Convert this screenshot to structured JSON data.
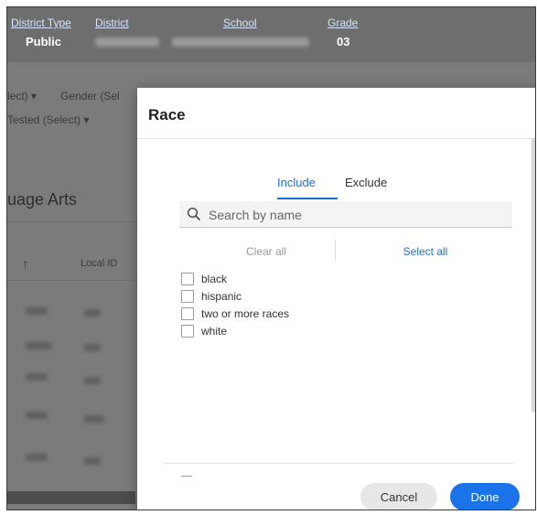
{
  "header": {
    "columns": [
      "District Type",
      "District",
      "School",
      "Grade"
    ],
    "values": {
      "district_type": "Public",
      "grade": "03"
    }
  },
  "background": {
    "filters": [
      "lect)",
      "Gender (Sel",
      "Tested (Select)"
    ],
    "section_title": "uage Arts",
    "table_headers": [
      "↑",
      "Local ID"
    ]
  },
  "modal": {
    "title": "Race",
    "tabs": {
      "include": "Include",
      "exclude": "Exclude",
      "active": "include"
    },
    "search": {
      "placeholder": "Search by name",
      "value": ""
    },
    "clear_all_label": "Clear all",
    "select_all_label": "Select all",
    "options": [
      "black",
      "hispanic",
      "two or more races",
      "white"
    ],
    "buttons": {
      "cancel": "Cancel",
      "done": "Done"
    }
  },
  "colors": {
    "accent": "#1a73e8",
    "link": "#1a6fd6"
  }
}
